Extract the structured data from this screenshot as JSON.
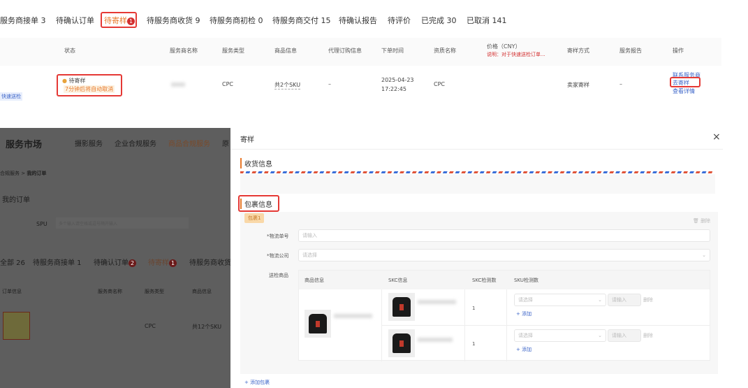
{
  "status_tabs": [
    {
      "label": "服务商接单 3"
    },
    {
      "label": "待确认订单"
    },
    {
      "label": "待寄样",
      "badge": "1"
    },
    {
      "label": "待服务商收货 9"
    },
    {
      "label": "待服务商初检 0"
    },
    {
      "label": "待服务商交付 15"
    },
    {
      "label": "待确认报告"
    },
    {
      "label": "待评价"
    },
    {
      "label": "已完成 30"
    },
    {
      "label": "已取消 141"
    }
  ],
  "table": {
    "headers": {
      "status": "状态",
      "provider": "服务商名称",
      "service_type": "服务类型",
      "product": "商品信息",
      "proxy": "代理订购信息",
      "order_time": "下单时间",
      "qualification": "资质名称",
      "price": "价格（CNY）",
      "price_note": "说明：对于快速送检订单...",
      "shipping": "寄样方式",
      "report": "服务报告",
      "actions": "操作"
    },
    "row": {
      "tag": "快速送检",
      "status": "待寄样",
      "countdown": "7分钟后将自动取消",
      "service_type": "CPC",
      "product": "共2个SKU",
      "proxy": "–",
      "order_time_date": "2025-04-23",
      "order_time_clock": "17:22:45",
      "qualification": "CPC",
      "shipping": "卖家寄样",
      "report": "–",
      "action_contact": "联系服务商",
      "action_ship": "去寄样",
      "action_detail": "查看详情"
    }
  },
  "background_page": {
    "brand": "服务市场",
    "nav": [
      "摄影服务",
      "企业合规服务",
      "商品合规服务",
      "原"
    ],
    "breadcrumb_parent": "合规服务",
    "breadcrumb_sep": ">",
    "breadcrumb_current": "我的订单",
    "page_title": "我的订单",
    "spu_label": "SPU",
    "spu_placeholder": "多个输入请空格或逗号隔开输入",
    "tabs": [
      {
        "label": "全部 26"
      },
      {
        "label": "待服务商接单 1"
      },
      {
        "label": "待确认订单",
        "badge": "2"
      },
      {
        "label": "待寄样",
        "badge": "1"
      },
      {
        "label": "待服务商收货"
      }
    ],
    "headers": [
      "订单信息",
      "服务商名称",
      "服务类型",
      "商品信息"
    ],
    "row": {
      "service_type": "CPC",
      "product": "共12个SKU"
    }
  },
  "modal": {
    "title": "寄样",
    "close": "×",
    "receive_section": "收货信息",
    "package_section": "包裹信息",
    "package_tag": "包裹1",
    "delete": "删除",
    "tracking_label": "*物流单号",
    "tracking_placeholder": "请输入",
    "company_label": "*物流公司",
    "company_placeholder": "请选择",
    "goods_label": "送检商品",
    "goods_headers": [
      "商品信息",
      "SKC信息",
      "SKC检测数",
      "SKU检测数"
    ],
    "goods_rows": [
      {
        "skc_count": "1",
        "sku_select": "请选择",
        "sku_input": "请输入",
        "remove": "删除",
        "add": "+ 添加"
      },
      {
        "skc_count": "1",
        "sku_select": "请选择",
        "sku_input": "请输入",
        "remove": "删除",
        "add": "+ 添加"
      }
    ],
    "add_package": "+ 添加包裹"
  },
  "colors": {
    "accent": "#e8792b",
    "highlight": "#e53935",
    "link": "#3b64c8"
  }
}
